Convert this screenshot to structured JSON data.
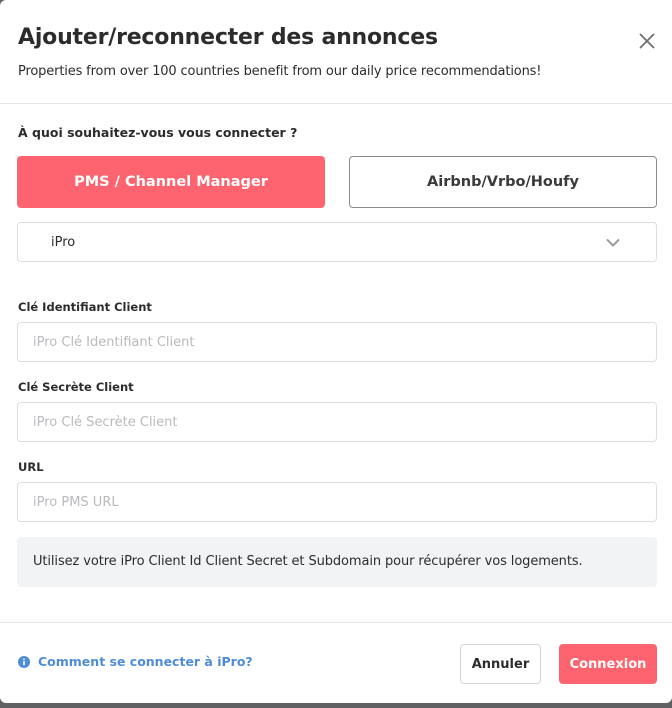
{
  "modal": {
    "title": "Ajouter/reconnecter des annonces",
    "subtitle": "Properties from over 100 countries benefit from our daily price recommendations!",
    "close_icon": "close-icon"
  },
  "connection": {
    "question": "À quoi souhaitez-vous vous connecter ?",
    "options": [
      {
        "label": "PMS / Channel Manager",
        "selected": true
      },
      {
        "label": "Airbnb/Vrbo/Houfy",
        "selected": false
      }
    ],
    "selected_pms": "iPro",
    "dropdown_icon": "chevron-down-icon"
  },
  "fields": {
    "client_id": {
      "label": "Clé Identifiant Client",
      "placeholder": "iPro Clé Identifiant Client",
      "value": ""
    },
    "client_secret": {
      "label": "Clé Secrète Client",
      "placeholder": "iPro Clé Secrète Client",
      "value": ""
    },
    "url": {
      "label": "URL",
      "placeholder": "iPro PMS URL",
      "value": ""
    }
  },
  "info": {
    "text": "Utilisez votre iPro Client Id Client Secret et Subdomain pour récupérer vos logements."
  },
  "footer": {
    "help_link": "Comment se connecter à iPro?",
    "help_icon": "info-icon",
    "cancel_label": "Annuler",
    "connect_label": "Connexion"
  },
  "colors": {
    "accent": "#fe646f",
    "link": "#4f8cd6",
    "info_bg": "#f2f3f5"
  }
}
